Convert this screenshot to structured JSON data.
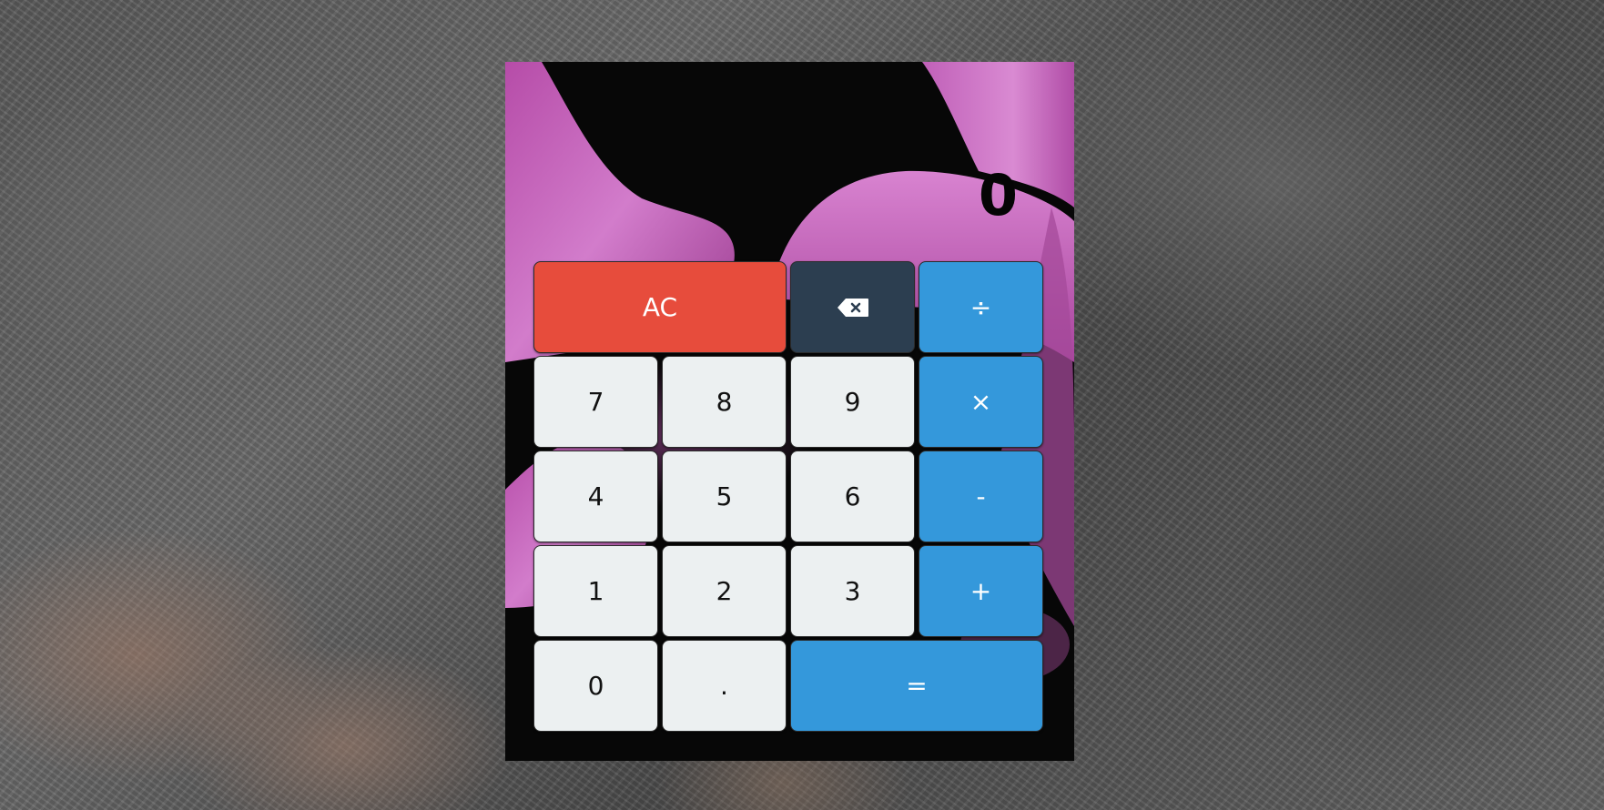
{
  "display": {
    "value": "0"
  },
  "colors": {
    "clear": "#e74c3c",
    "backspace": "#2c3e50",
    "operator": "#3498db",
    "digit": "#ecf0f1",
    "accent_wallpaper": "#c865c0"
  },
  "keys": {
    "clear": "AC",
    "backspace_icon": "backspace-icon",
    "divide": "÷",
    "seven": "7",
    "eight": "8",
    "nine": "9",
    "multiply": "×",
    "four": "4",
    "five": "5",
    "six": "6",
    "subtract": "-",
    "one": "1",
    "two": "2",
    "three": "3",
    "add": "+",
    "zero": "0",
    "decimal": ".",
    "equals": "="
  }
}
